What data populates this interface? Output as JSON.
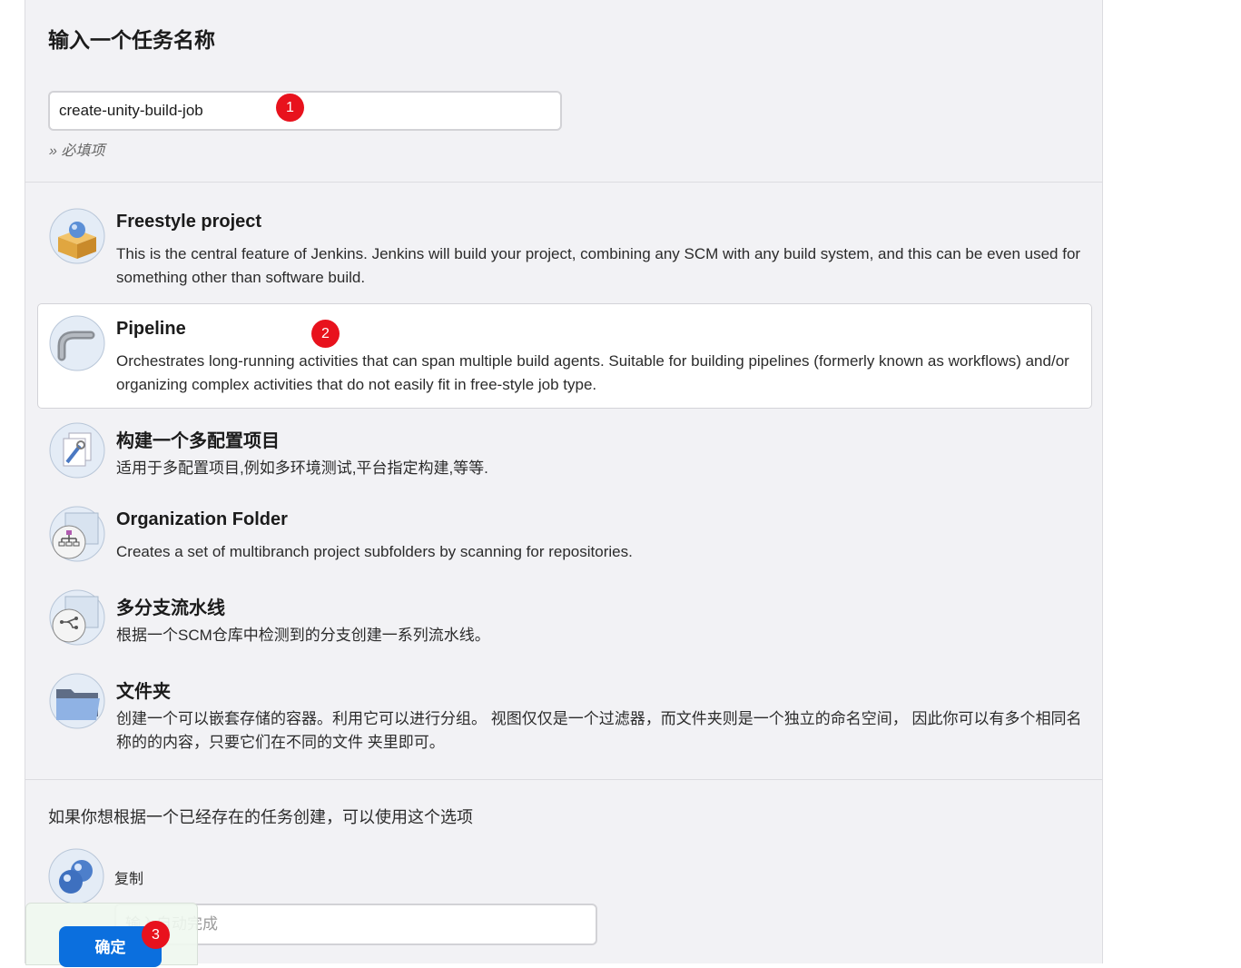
{
  "header": {
    "title": "输入一个任务名称"
  },
  "name_field": {
    "value": "create-unity-build-job",
    "hint": "» 必填项"
  },
  "job_types": [
    {
      "title": "Freestyle project",
      "description": "This is the central feature of Jenkins. Jenkins will build your project, combining any SCM with any build system, and this can be even used for something other than software build.",
      "icon": "freestyle-box-icon"
    },
    {
      "title": "Pipeline",
      "description": "Orchestrates long-running activities that can span multiple build agents. Suitable for building pipelines (formerly known as workflows) and/or organizing complex activities that do not easily fit in free-style job type.",
      "icon": "pipe-icon"
    },
    {
      "title": "构建一个多配置项目",
      "description": "适用于多配置项目,例如多环境测试,平台指定构建,等等.",
      "icon": "multi-config-icon"
    },
    {
      "title": "Organization Folder",
      "description": "Creates a set of multibranch project subfolders by scanning for repositories.",
      "icon": "organization-folder-icon"
    },
    {
      "title": "多分支流水线",
      "description": "根据一个SCM仓库中检测到的分支创建一系列流水线。",
      "icon": "multibranch-icon"
    },
    {
      "title": "文件夹",
      "description": "创建一个可以嵌套存储的容器。利用它可以进行分组。 视图仅仅是一个过滤器，而文件夹则是一个独立的命名空间， 因此你可以有多个相同名称的的内容，只要它们在不同的文件 夹里即可。",
      "icon": "folder-icon"
    }
  ],
  "copy_section": {
    "label": "如果你想根据一个已经存在的任务创建，可以使用这个选项",
    "option": "复制",
    "placeholder": "输入自动完成"
  },
  "footer": {
    "ok_label": "确定"
  },
  "annotations": [
    "1",
    "2",
    "3"
  ],
  "colors": {
    "accent": "#0b6fde",
    "badge": "#e8121d",
    "panel": "#f2f2f5"
  }
}
